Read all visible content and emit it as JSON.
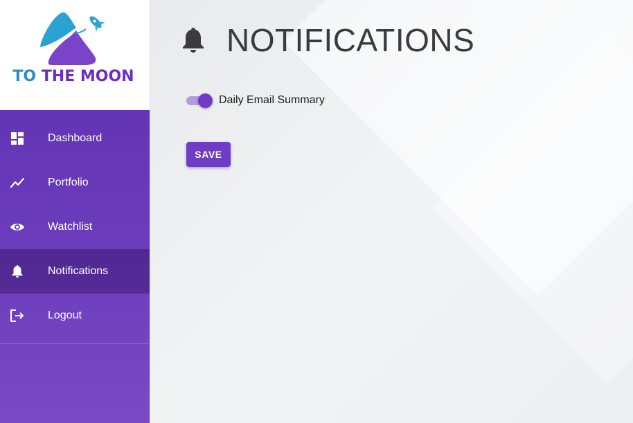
{
  "brand": {
    "logo_text_to": "TO",
    "logo_text_rest": "THE MOON",
    "colors": {
      "purple": "#6a2fc1",
      "blue": "#2b8fc7"
    }
  },
  "sidebar": {
    "items": [
      {
        "label": "Dashboard",
        "icon": "dashboard-icon",
        "active": false
      },
      {
        "label": "Portfolio",
        "icon": "trending-line-icon",
        "active": false
      },
      {
        "label": "Watchlist",
        "icon": "eye-icon",
        "active": false
      },
      {
        "label": "Notifications",
        "icon": "bell-icon",
        "active": true
      },
      {
        "label": "Logout",
        "icon": "logout-icon",
        "active": false
      }
    ],
    "accent": "#5d2fb0"
  },
  "main": {
    "title": "NOTIFICATIONS",
    "title_icon": "bell-icon",
    "settings": [
      {
        "label": "Daily Email Summary",
        "enabled": true
      }
    ],
    "save_label": "SAVE",
    "accent": "#6f3cc3"
  }
}
